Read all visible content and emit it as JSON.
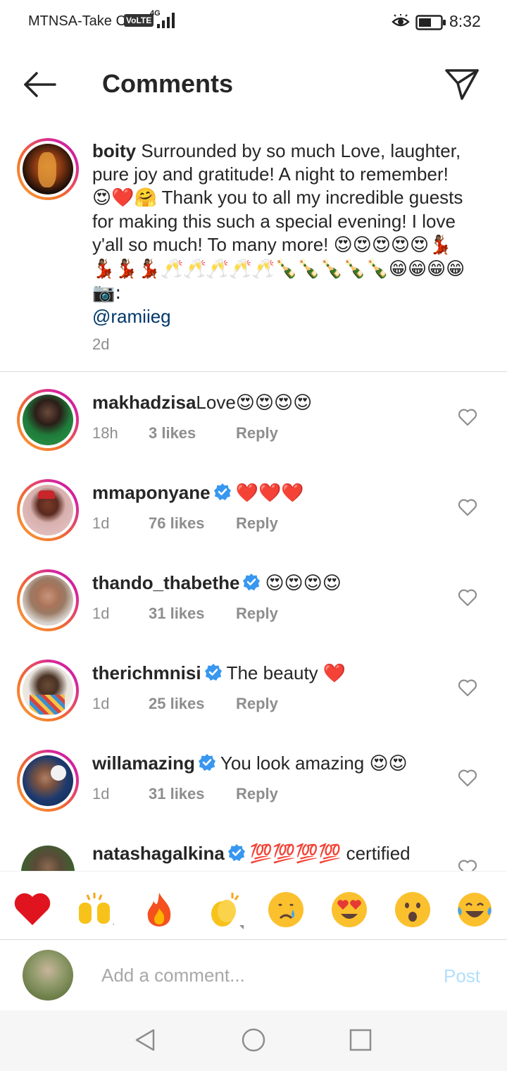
{
  "status_bar": {
    "carrier": "MTNSA-Take Ca",
    "volte": "VoLTE",
    "network": "4G",
    "time": "8:32"
  },
  "header": {
    "title": "Comments",
    "back_icon": "arrow-left-icon",
    "share_icon": "paper-plane-icon"
  },
  "caption": {
    "username": "boity",
    "text_1": " Surrounded by so much Love, laughter, pure joy and gratitude! A night to remember! ",
    "emoji_1": "😍❤️🤗",
    "text_2": " Thank you to all my incredible guests for making this such a special evening! I love y'all so much! To many more! ",
    "emoji_2": "😍😍😍😍😍💃🏾💃🏾💃🏾💃🏾🥂🥂🥂🥂🥂🍾🍾🍾🍾🍾😁😁😁😁 📷:",
    "mention": "@ramiieg",
    "time": "2d"
  },
  "comments": [
    {
      "username": "makhadzisa",
      "verified": false,
      "text": "Love",
      "emoji": "😍😍😍😍",
      "time": "18h",
      "likes": "3 likes",
      "reply": "Reply"
    },
    {
      "username": "mmaponyane",
      "verified": true,
      "text": "",
      "emoji": "❤️❤️❤️",
      "time": "1d",
      "likes": "76 likes",
      "reply": "Reply"
    },
    {
      "username": "thando_thabethe",
      "verified": true,
      "text": "",
      "emoji": "😍😍😍😍",
      "time": "1d",
      "likes": "31 likes",
      "reply": "Reply"
    },
    {
      "username": "therichmnisi",
      "verified": true,
      "text": "The beauty ",
      "emoji": "❤️",
      "time": "1d",
      "likes": "25 likes",
      "reply": "Reply"
    },
    {
      "username": "willamazing",
      "verified": true,
      "text": "You look amazing ",
      "emoji": "😍😍",
      "time": "1d",
      "likes": "31 likes",
      "reply": "Reply"
    },
    {
      "username": "natashagalkina",
      "verified": true,
      "text": " certified",
      "emoji": "💯💯💯💯",
      "time": "",
      "likes": "",
      "reply": ""
    }
  ],
  "reactions": [
    "❤️",
    "🙌",
    "🔥",
    "👏",
    "😢",
    "😍",
    "😮",
    "😂"
  ],
  "composer": {
    "placeholder": "Add a comment...",
    "post": "Post"
  },
  "colors": {
    "verified_blue": "#3897f0",
    "like_heart": "#ed4956",
    "post_disabled": "#b2dffc",
    "mention": "#00376b"
  }
}
